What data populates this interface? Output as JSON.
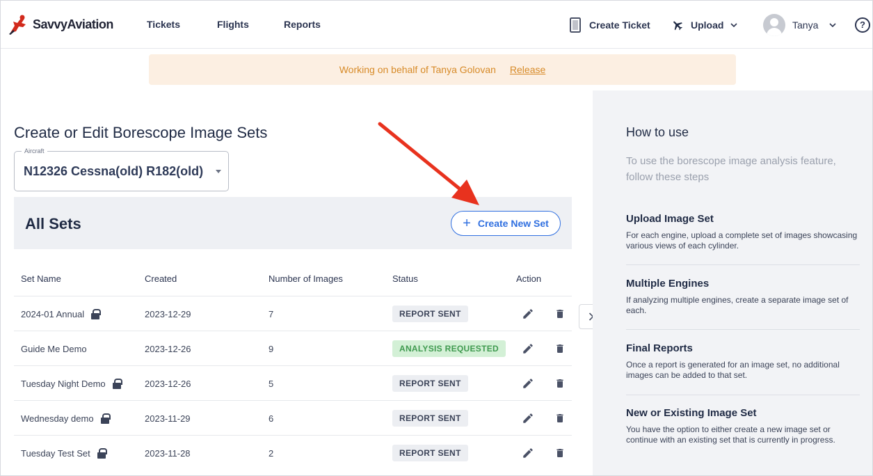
{
  "brand": {
    "name": "SavvyAviation"
  },
  "nav": {
    "tickets": "Tickets",
    "flights": "Flights",
    "reports": "Reports"
  },
  "topbar": {
    "create_ticket": "Create Ticket",
    "upload": "Upload",
    "user_name": "Tanya",
    "help": "?"
  },
  "banner": {
    "text": "Working on behalf of Tanya Golovan",
    "release": "Release"
  },
  "main": {
    "title": "Create or Edit Borescope Image Sets",
    "aircraft_label": "Aircraft",
    "aircraft_value": "N12326 Cessna(old) R182(old)",
    "sets_title": "All Sets",
    "create_set": "Create New Set"
  },
  "table": {
    "headers": {
      "name": "Set Name",
      "created": "Created",
      "images": "Number of Images",
      "status": "Status",
      "action": "Action"
    },
    "rows": [
      {
        "name": "2024-01 Annual",
        "locked": true,
        "created": "2023-12-29",
        "images": "7",
        "status": "REPORT SENT",
        "status_color": "#eceef2"
      },
      {
        "name": "Guide Me Demo",
        "locked": false,
        "created": "2023-12-26",
        "images": "9",
        "status": "ANALYSIS REQUESTED",
        "status_color": "#d3f0d6"
      },
      {
        "name": "Tuesday Night Demo",
        "locked": true,
        "created": "2023-12-26",
        "images": "5",
        "status": "REPORT SENT",
        "status_color": "#eceef2"
      },
      {
        "name": "Wednesday demo",
        "locked": true,
        "created": "2023-11-29",
        "images": "6",
        "status": "REPORT SENT",
        "status_color": "#eceef2"
      },
      {
        "name": "Tuesday Test Set",
        "locked": true,
        "created": "2023-11-28",
        "images": "2",
        "status": "REPORT SENT",
        "status_color": "#eceef2"
      }
    ]
  },
  "side": {
    "title": "How to use",
    "intro": "To use the borescope image analysis feature, follow these steps",
    "steps": [
      {
        "title": "Upload Image Set",
        "text": "For each engine, upload a complete set of images showcasing various views of each cylinder."
      },
      {
        "title": "Multiple Engines",
        "text": "If analyzing multiple engines, create a separate image set of each."
      },
      {
        "title": "Final Reports",
        "text": "Once a report is generated for an image set, no additional images can be added to that set."
      },
      {
        "title": "New or Existing Image Set",
        "text": "You have the option to either create a new image set or continue with an existing set that is currently in progress."
      }
    ]
  },
  "colors": {
    "accent": "#2f6fe0",
    "banner_bg": "#fcefe2",
    "banner_text": "#d78a27",
    "annotation_arrow": "#e8321e",
    "logo_red": "#d22a1c"
  }
}
